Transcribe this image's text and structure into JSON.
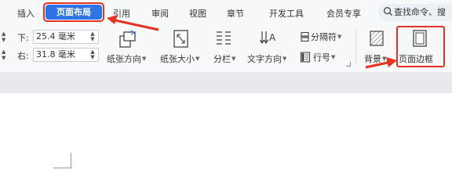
{
  "tabs": [
    {
      "label": "插入",
      "active": false
    },
    {
      "label": "页面布局",
      "active": true
    },
    {
      "label": "引用",
      "active": false
    },
    {
      "label": "审阅",
      "active": false
    },
    {
      "label": "视图",
      "active": false
    },
    {
      "label": "章节",
      "active": false
    },
    {
      "label": "开发工具",
      "active": false
    },
    {
      "label": "会员专享",
      "active": false
    }
  ],
  "search": {
    "text": "查找命令、搜"
  },
  "margins": {
    "bottom": {
      "label": "下:",
      "value": "25.4 毫米"
    },
    "right": {
      "label": "右:",
      "value": "31.8 毫米"
    }
  },
  "ribbon": {
    "orientation_label": "纸张方向",
    "size_label": "纸张大小",
    "columns_label": "分栏",
    "text_direction_label": "文字方向",
    "separator_label": "分隔符",
    "line_number_label": "行号",
    "background_label": "背景",
    "page_border_label": "页面边框"
  },
  "colors": {
    "accent": "#2f74e6",
    "annotation": "#e53223",
    "ribbon_bg": "#f7f8fa"
  },
  "icons": [
    "search-icon",
    "paper-orientation-icon",
    "paper-size-icon",
    "columns-icon",
    "text-direction-icon",
    "separator-icon",
    "line-number-icon",
    "background-icon",
    "page-border-icon"
  ]
}
